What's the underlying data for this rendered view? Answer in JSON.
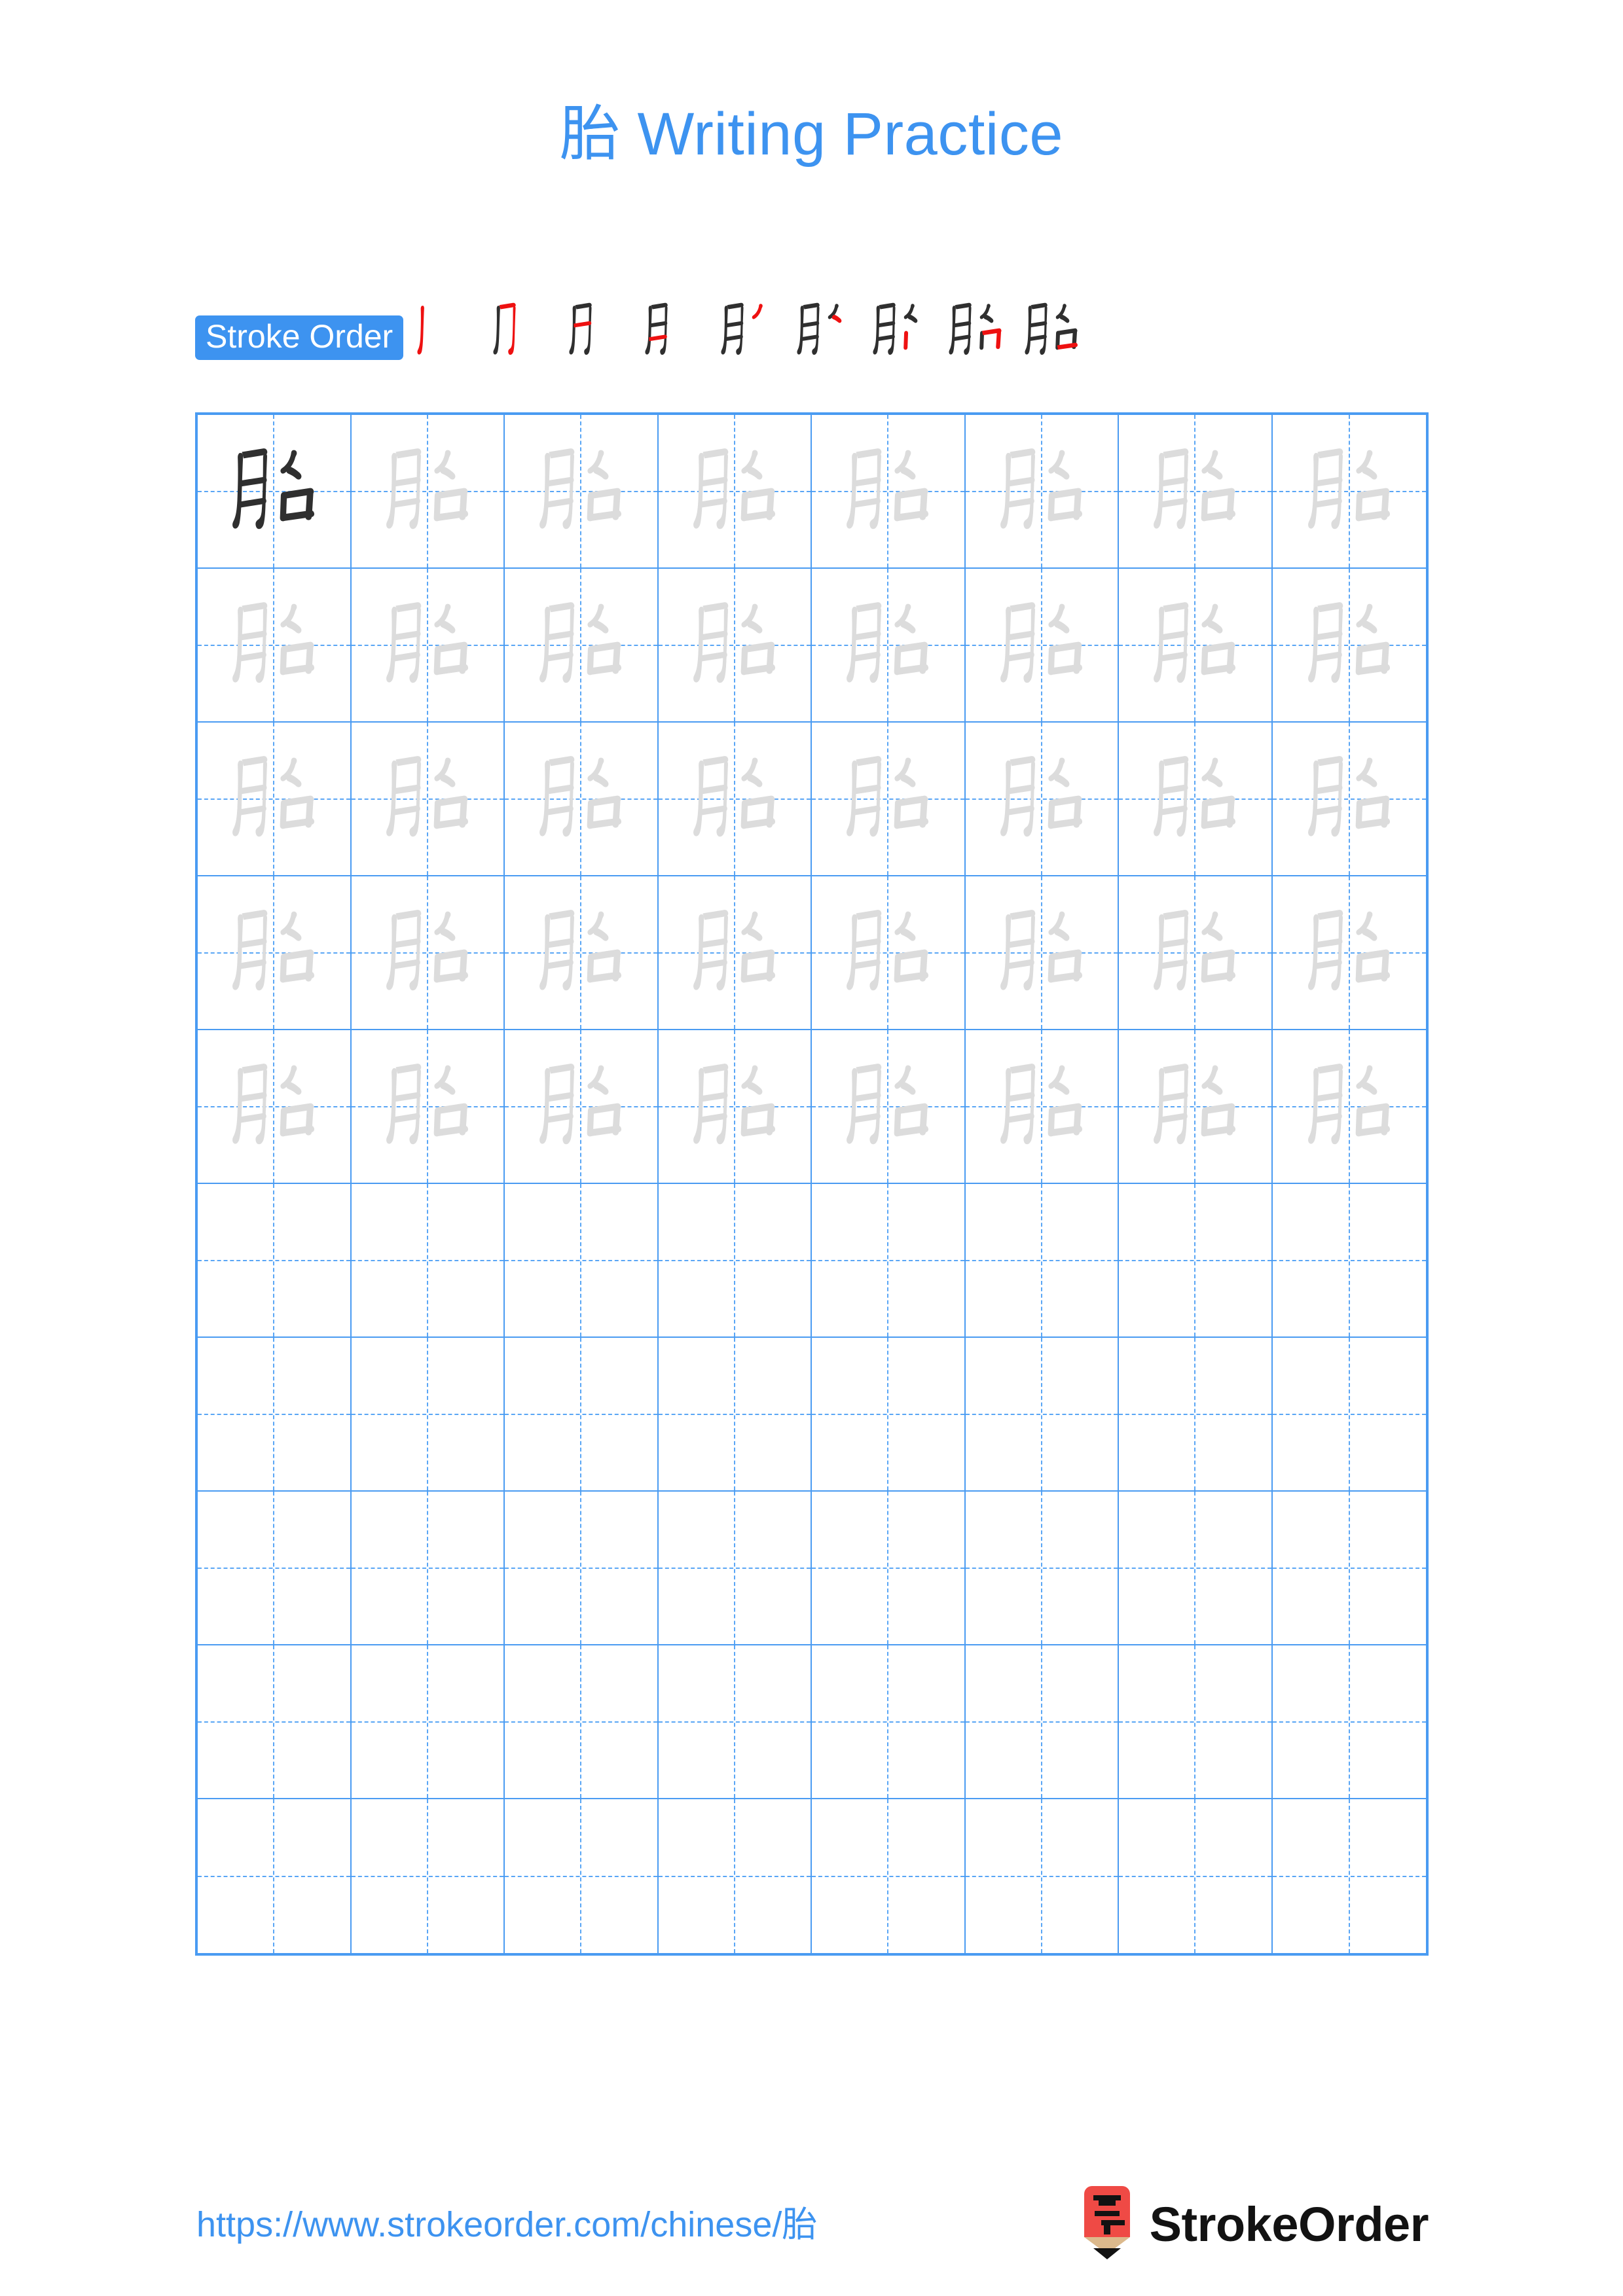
{
  "page": {
    "character": "胎",
    "background_color": "#ffffff",
    "accent_color": "#3d93f0",
    "stroke_new_color": "#ee1111",
    "stroke_done_color": "#2f2f2f",
    "trace_color": "#dcdcdc",
    "grid_line_color": "#4a9bf2"
  },
  "title": {
    "character": "胎",
    "text": " Writing Practice",
    "full": "胎 Writing Practice"
  },
  "stroke_order": {
    "badge_label": "Stroke Order",
    "total_strokes": 9,
    "steps": [
      {
        "index": 1,
        "strokes_shown": 1,
        "new_stroke": 1
      },
      {
        "index": 2,
        "strokes_shown": 2,
        "new_stroke": 2
      },
      {
        "index": 3,
        "strokes_shown": 3,
        "new_stroke": 3
      },
      {
        "index": 4,
        "strokes_shown": 4,
        "new_stroke": 4
      },
      {
        "index": 5,
        "strokes_shown": 5,
        "new_stroke": 5
      },
      {
        "index": 6,
        "strokes_shown": 6,
        "new_stroke": 6
      },
      {
        "index": 7,
        "strokes_shown": 7,
        "new_stroke": 7
      },
      {
        "index": 8,
        "strokes_shown": 8,
        "new_stroke": 8
      },
      {
        "index": 9,
        "strokes_shown": 9,
        "new_stroke": 9
      }
    ]
  },
  "grid": {
    "columns": 8,
    "rows": 10,
    "model_cell": {
      "row": 1,
      "column": 1,
      "character": "胎",
      "style": "model"
    },
    "trace_rows": [
      1,
      2,
      3,
      4,
      5
    ],
    "empty_rows": [
      6,
      7,
      8,
      9,
      10
    ],
    "cell_character": "胎"
  },
  "footer": {
    "url_prefix": "https://www.strokeorder.com/chinese/",
    "url_character": "胎",
    "url_full": "https://www.strokeorder.com/chinese/胎",
    "logo_character": "字",
    "logo_text": "StrokeOrder",
    "logo_body_color": "#ef4a45",
    "logo_wood_color": "#dcb98c",
    "logo_tip_color": "#121212"
  }
}
